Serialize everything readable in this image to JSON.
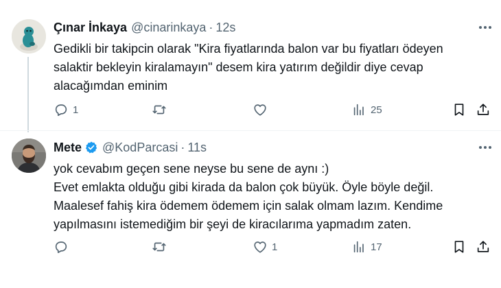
{
  "tweets": [
    {
      "name": "Çınar İnkaya",
      "handle": "@cinarinkaya",
      "separator": "·",
      "time": "12s",
      "text_lines": [
        "Gedikli bir takipcin olarak \"Kira fiyatlarında balon var bu fiyatları ödeyen",
        "salaktir bekleyin kiralamayın\" desem kira yatırım değildir diye cevap",
        "alacağımdan eminim"
      ],
      "reply_count": "1",
      "retweet_count": "",
      "like_count": "",
      "view_count": "25",
      "verified": false
    },
    {
      "name": "Mete",
      "handle": "@KodParcasi",
      "separator": "·",
      "time": "11s",
      "text_lines": [
        "yok cevabım geçen sene neyse bu sene de aynı :)",
        "Evet emlakta olduğu gibi kirada da balon çok büyük. Öyle böyle değil.",
        "Maalesef fahiş kira ödemem ödemem için salak olmam lazım. Kendime",
        "yapılmasını istemediğim bir şeyi de kiracılarıma yapmadım zaten."
      ],
      "reply_count": "",
      "retweet_count": "",
      "like_count": "1",
      "view_count": "17",
      "verified": true
    }
  ],
  "colors": {
    "text": "#0f1419",
    "secondary": "#536471",
    "verified": "#1d9bf0",
    "thread_line": "#cfd9de"
  },
  "icons": [
    "more-icon",
    "reply-icon",
    "retweet-icon",
    "like-icon",
    "views-icon",
    "bookmark-icon",
    "share-icon",
    "verified-badge-icon"
  ]
}
